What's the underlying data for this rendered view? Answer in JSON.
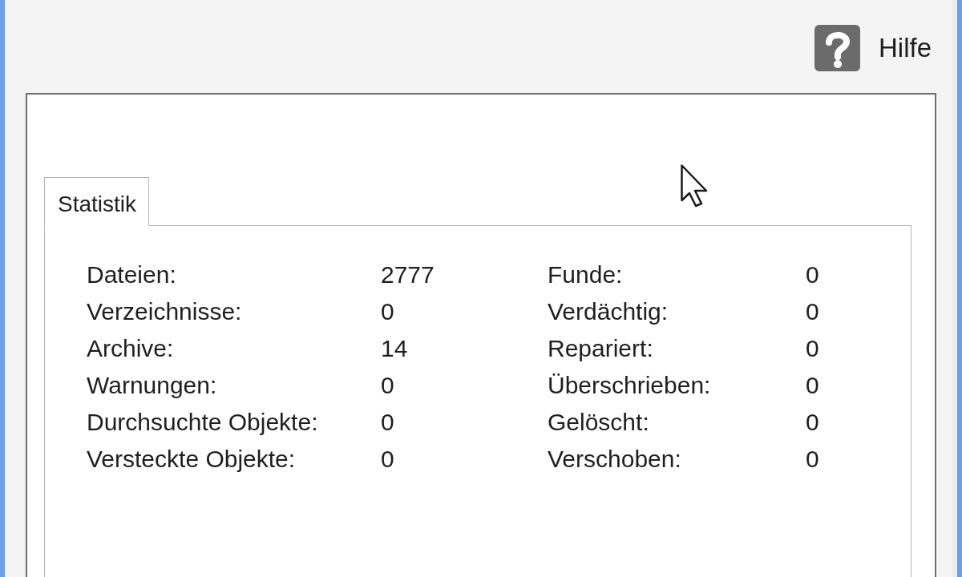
{
  "help": {
    "label": "Hilfe"
  },
  "tabs": [
    {
      "label": "Statistik",
      "selected": true
    }
  ],
  "statistics": {
    "left_column": [
      {
        "label": "Dateien:",
        "value": "2777"
      },
      {
        "label": "Verzeichnisse:",
        "value": "0"
      },
      {
        "label": "Archive:",
        "value": "14"
      },
      {
        "label": "Warnungen:",
        "value": "0"
      },
      {
        "label": "Durchsuchte Objekte:",
        "value": "0"
      },
      {
        "label": "Versteckte Objekte:",
        "value": "0"
      }
    ],
    "right_column": [
      {
        "label": "Funde:",
        "value": "0"
      },
      {
        "label": "Verdächtig:",
        "value": "0"
      },
      {
        "label": "Repariert:",
        "value": "0"
      },
      {
        "label": "Überschrieben:",
        "value": "0"
      },
      {
        "label": "Gelöscht:",
        "value": "0"
      },
      {
        "label": "Verschoben:",
        "value": "0"
      }
    ]
  }
}
